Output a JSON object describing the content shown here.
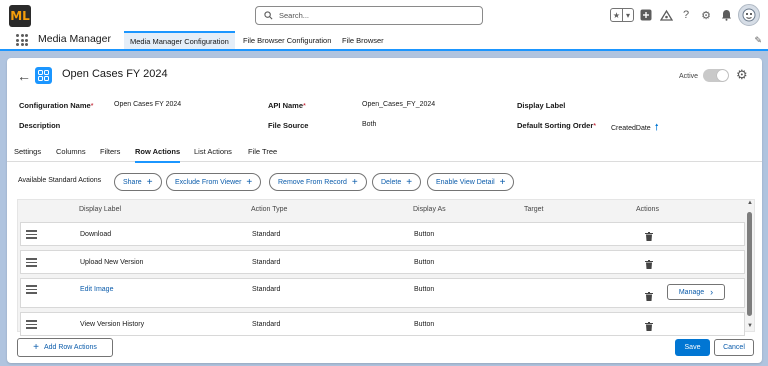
{
  "global_header": {
    "logo_text": "ML",
    "search_placeholder": "Search..."
  },
  "app_nav": {
    "app_name": "Media Manager",
    "tabs": [
      {
        "label": "Media Manager Configuration",
        "active": true
      },
      {
        "label": "File Browser Configuration",
        "active": false
      },
      {
        "label": "File Browser",
        "active": false
      }
    ]
  },
  "record": {
    "title": "Open Cases FY 2024",
    "active_label": "Active",
    "active": false
  },
  "fields": {
    "configuration_name_label": "Configuration Name",
    "configuration_name_value": "Open Cases FY 2024",
    "api_name_label": "API Name",
    "api_name_value": "Open_Cases_FY_2024",
    "display_label_label": "Display Label",
    "display_label_value": "",
    "description_label": "Description",
    "description_value": "",
    "file_source_label": "File Source",
    "file_source_value": "Both",
    "default_sorting_label": "Default Sorting Order",
    "default_sorting_value": "CreatedDate",
    "required_marker": "*"
  },
  "sub_tabs": [
    {
      "label": "Settings",
      "active": false
    },
    {
      "label": "Columns",
      "active": false
    },
    {
      "label": "Filters",
      "active": false
    },
    {
      "label": "Row Actions",
      "active": true
    },
    {
      "label": "List Actions",
      "active": false
    },
    {
      "label": "File Tree",
      "active": false
    }
  ],
  "standard_actions": {
    "label": "Available Standard Actions",
    "items": [
      "Share",
      "Exclude From Viewer",
      "Remove From Record",
      "Delete",
      "Enable View Detail"
    ]
  },
  "table": {
    "headers": {
      "display_label": "Display Label",
      "action_type": "Action Type",
      "display_as": "Display As",
      "target": "Target",
      "actions": "Actions"
    },
    "rows": [
      {
        "display_label": "Download",
        "action_type": "Standard",
        "display_as": "Button",
        "target": "",
        "link": false,
        "manage": false
      },
      {
        "display_label": "Upload New Version",
        "action_type": "Standard",
        "display_as": "Button",
        "target": "",
        "link": false,
        "manage": false
      },
      {
        "display_label": "Edit Image",
        "action_type": "Standard",
        "display_as": "Button",
        "target": "",
        "link": true,
        "manage": true,
        "manage_label": "Manage"
      },
      {
        "display_label": "View Version History",
        "action_type": "Standard",
        "display_as": "Button",
        "target": "",
        "link": false,
        "manage": false
      }
    ]
  },
  "footer": {
    "add_row_actions_label": "Add Row Actions",
    "save_label": "Save",
    "cancel_label": "Cancel"
  },
  "colors": {
    "brand_blue": "#0176d3",
    "link_blue": "#0b5cab",
    "required_red": "#ba0517",
    "background": "#b0c4df"
  }
}
